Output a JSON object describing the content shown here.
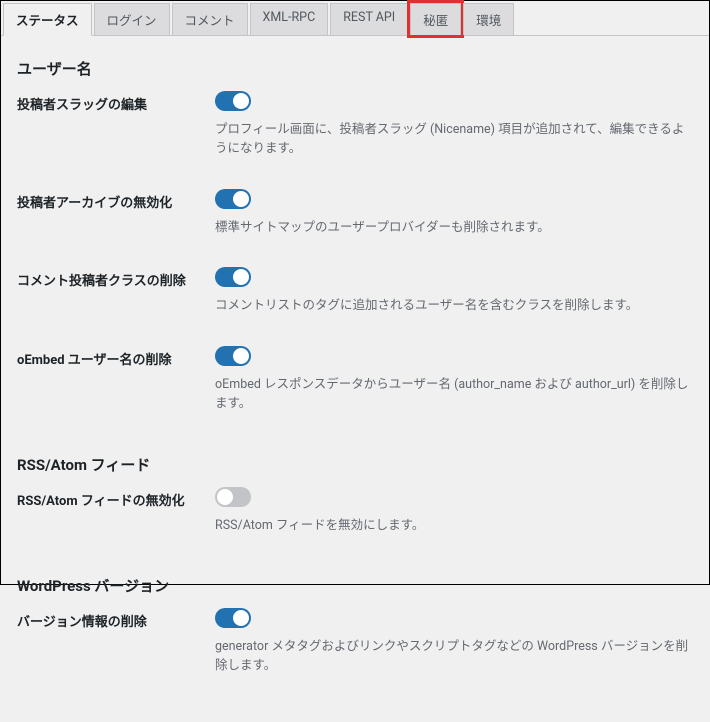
{
  "tabs": [
    {
      "label": "ステータス",
      "active": true
    },
    {
      "label": "ログイン"
    },
    {
      "label": "コメント"
    },
    {
      "label": "XML-RPC"
    },
    {
      "label": "REST API"
    },
    {
      "label": "秘匿",
      "highlight": true
    },
    {
      "label": "環境"
    }
  ],
  "sections": {
    "username": {
      "heading": "ユーザー名",
      "rows": [
        {
          "label": "投稿者スラッグの編集",
          "on": true,
          "desc": "プロフィール画面に、投稿者スラッグ (Nicename) 項目が追加されて、編集できるようになります。"
        },
        {
          "label": "投稿者アーカイブの無効化",
          "on": true,
          "desc": "標準サイトマップのユーザープロバイダーも削除されます。"
        },
        {
          "label": "コメント投稿者クラスの削除",
          "on": true,
          "desc": "コメントリストのタグに追加されるユーザー名を含むクラスを削除します。"
        },
        {
          "label": "oEmbed ユーザー名の削除",
          "on": true,
          "desc": "oEmbed レスポンスデータからユーザー名 (author_name および author_url) を削除します。"
        }
      ]
    },
    "rss": {
      "heading": "RSS/Atom フィード",
      "rows": [
        {
          "label": "RSS/Atom フィードの無効化",
          "on": false,
          "desc": "RSS/Atom フィードを無効にします。"
        }
      ]
    },
    "wp": {
      "heading": "WordPress バージョン",
      "rows": [
        {
          "label": "バージョン情報の削除",
          "on": true,
          "desc": "generator メタタグおよびリンクやスクリプトタグなどの WordPress バージョンを削除します。"
        }
      ]
    }
  }
}
